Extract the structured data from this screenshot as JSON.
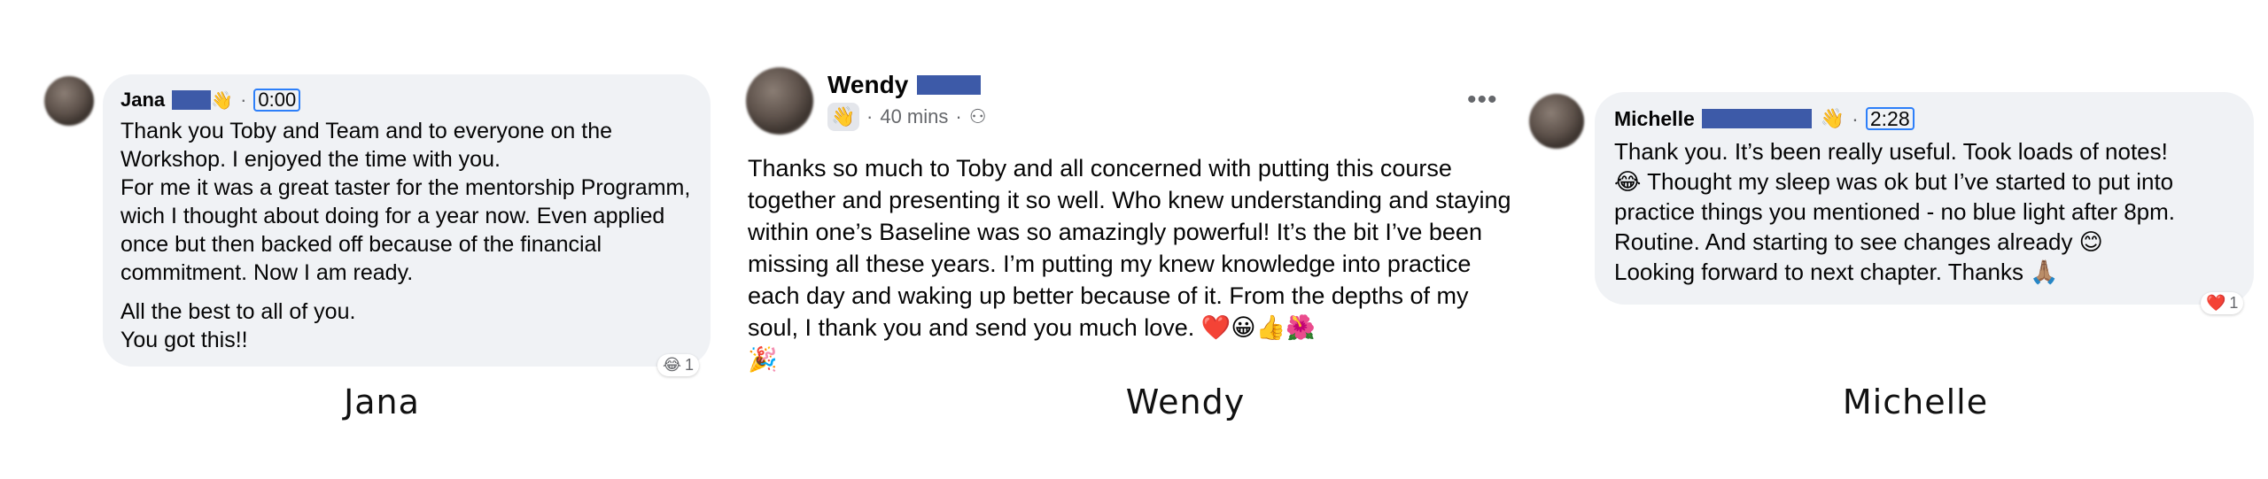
{
  "comments": {
    "jana": {
      "name": "Jana",
      "time": "0:00",
      "paragraphs": [
        "Thank you Toby and Team and to everyone on the Workshop. I enjoyed the time with you.\nFor me it was a great taster for the mentorship Programm, wich I thought about doing for a year now. Even applied once but then backed off because of the financial commitment. Now I am ready.",
        "All the best to all of you.\nYou got this!!"
      ],
      "reaction_count": "1",
      "caption": "Jana"
    },
    "wendy": {
      "name": "Wendy",
      "time": "40 mins",
      "text": "Thanks so much to Toby and all concerned with putting this course together and presenting it so well. Who knew understanding and staying within one’s Baseline was so amazingly powerful! It’s the bit I’ve been missing all these years. I’m putting my knew knowledge into practice each day and waking up better because of it. From the depths of my soul, I thank you and send you much love. ❤️😀👍🌺\n🎉",
      "caption": "Wendy"
    },
    "michelle": {
      "name": "Michelle",
      "time": "2:28",
      "text": "Thank you. It’s been really useful. Took loads of notes!\n😂 Thought my sleep was ok but I’ve started to put into practice things you mentioned - no blue light after 8pm. Routine. And starting to see changes already 😊\nLooking forward to next chapter. Thanks 🙏🏽",
      "reaction_count": "1",
      "caption": "Michelle"
    }
  },
  "icons": {
    "wave": "👋",
    "friends": "⚇",
    "more": "•••",
    "haha_reaction": "😂",
    "love_reaction": "❤️"
  },
  "colors": {
    "bubble": "#f0f2f5",
    "redaction": "#3d5aa8",
    "time_highlight": "#2d7ff9"
  }
}
